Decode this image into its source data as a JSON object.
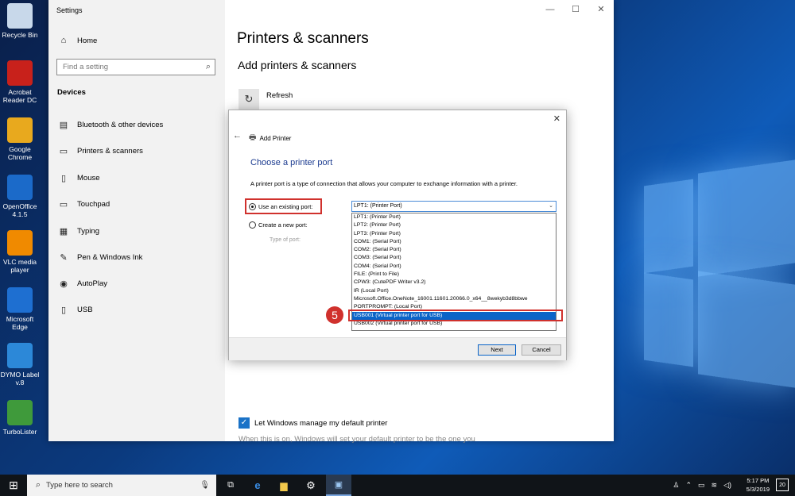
{
  "desktop": {
    "icons": [
      {
        "label": "Recycle Bin",
        "icon": "recycle-bin-icon",
        "color": "#c8d8ea"
      },
      {
        "label": "Acrobat Reader DC",
        "icon": "acrobat-icon",
        "color": "#c8211b"
      },
      {
        "label": "Google Chrome",
        "icon": "chrome-icon",
        "color": "#e8a91e"
      },
      {
        "label": "OpenOffice 4.1.5",
        "icon": "openoffice-icon",
        "color": "#1b6ac9"
      },
      {
        "label": "VLC media player",
        "icon": "vlc-icon",
        "color": "#f08a00"
      },
      {
        "label": "Microsoft Edge",
        "icon": "edge-icon",
        "color": "#1e6fd1"
      },
      {
        "label": "DYMO Label v.8",
        "icon": "dymo-icon",
        "color": "#2c88d8"
      },
      {
        "label": "TurboLister",
        "icon": "turbolister-icon",
        "color": "#3f9a3b"
      }
    ]
  },
  "settings": {
    "app_title": "Settings",
    "home_label": "Home",
    "search_placeholder": "Find a setting",
    "section_label": "Devices",
    "nav_items": [
      {
        "label": "Bluetooth & other devices",
        "icon": "bluetooth-icon"
      },
      {
        "label": "Printers & scanners",
        "icon": "printer-icon"
      },
      {
        "label": "Mouse",
        "icon": "mouse-icon"
      },
      {
        "label": "Touchpad",
        "icon": "touchpad-icon"
      },
      {
        "label": "Typing",
        "icon": "keyboard-icon"
      },
      {
        "label": "Pen & Windows Ink",
        "icon": "pen-icon"
      },
      {
        "label": "AutoPlay",
        "icon": "autoplay-icon"
      },
      {
        "label": "USB",
        "icon": "usb-icon"
      }
    ],
    "page_title": "Printers & scanners",
    "subtitle": "Add printers & scanners",
    "refresh_label": "Refresh",
    "default_printer_label": "Let Windows manage my default printer",
    "default_printer_desc": "When this is on, Windows will set your default printer to be the one you"
  },
  "dialog": {
    "title": "Add Printer",
    "heading": "Choose a printer port",
    "description": "A printer port is a type of connection that allows your computer to exchange information with a printer.",
    "use_existing_label": "Use an existing port:",
    "create_new_label": "Create a new port:",
    "type_of_port_label": "Type of port:",
    "selected_port": "LPT1: (Printer Port)",
    "port_options": [
      "LPT1: (Printer Port)",
      "LPT2: (Printer Port)",
      "LPT3: (Printer Port)",
      "COM1: (Serial Port)",
      "COM2: (Serial Port)",
      "COM3: (Serial Port)",
      "COM4: (Serial Port)",
      "FILE: (Print to File)",
      "CPW3: (CutePDF Writer v3.2)",
      "IR (Local Port)",
      "Microsoft.Office.OneNote_16001.11601.20066.0_x64__8wekyb3d8bbwe",
      "PORTPROMPT: (Local Port)",
      "USB001 (Virtual printer port for USB)",
      "USB002 (Virtual printer port for USB)"
    ],
    "highlighted_option_index": 12,
    "step_number": "5",
    "next_label": "Next",
    "cancel_label": "Cancel"
  },
  "taskbar": {
    "search_placeholder": "Type here to search",
    "time": "5:17 PM",
    "date": "5/3/2019",
    "notification_count": "20"
  },
  "colors": {
    "accent": "#0a64c8",
    "highlight_red": "#d0312d"
  }
}
